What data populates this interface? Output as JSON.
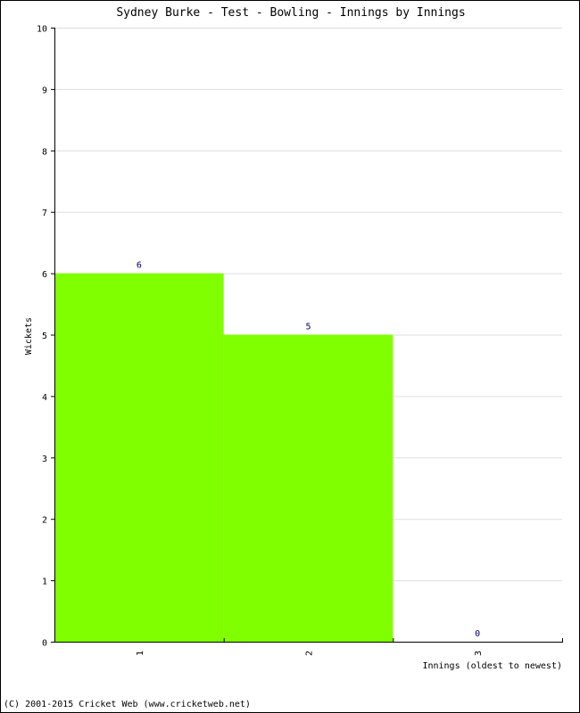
{
  "chart_data": {
    "type": "bar",
    "title": "Sydney Burke - Test - Bowling - Innings by Innings",
    "xlabel": "Innings (oldest to newest)",
    "ylabel": "Wickets",
    "categories": [
      "1",
      "2",
      "3"
    ],
    "values": [
      6,
      5,
      0
    ],
    "data_labels": [
      "6",
      "5",
      "0"
    ],
    "ylim": [
      0,
      10
    ],
    "yticks": [
      "0",
      "1",
      "2",
      "3",
      "4",
      "5",
      "6",
      "7",
      "8",
      "9",
      "10"
    ],
    "grid": true,
    "bar_color": "#80FF00",
    "value_label_color": "#000066"
  },
  "footer": "(C) 2001-2015 Cricket Web (www.cricketweb.net)"
}
